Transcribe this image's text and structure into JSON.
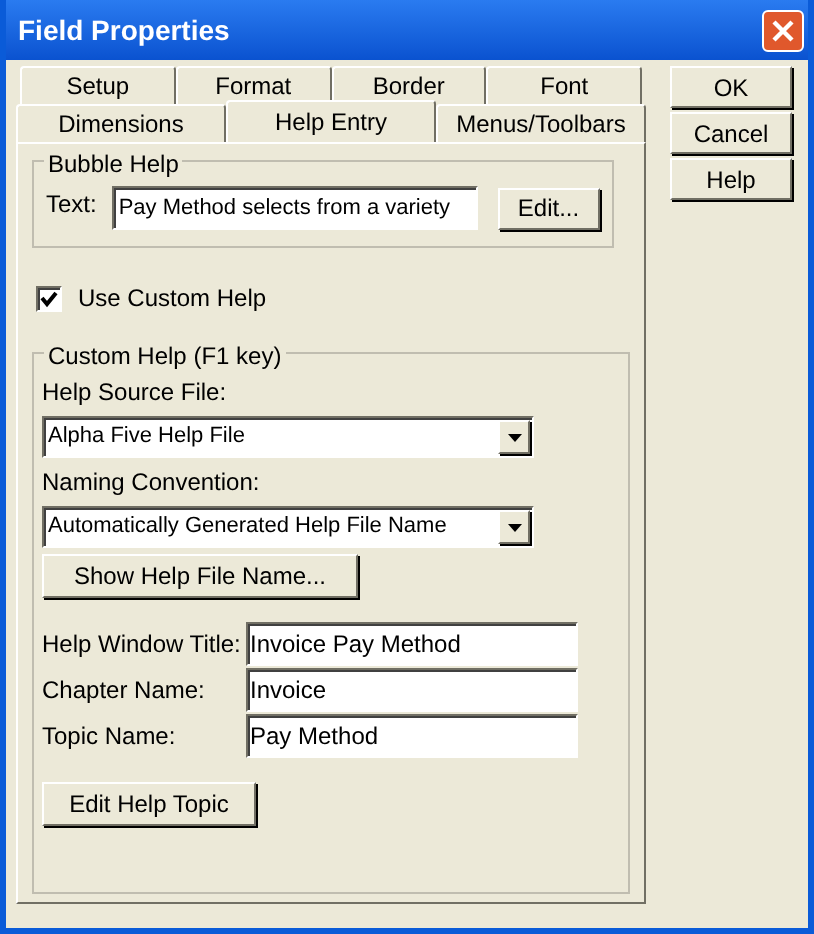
{
  "window": {
    "title": "Field Properties"
  },
  "tab_rows": [
    [
      {
        "label": "Setup",
        "selected": false
      },
      {
        "label": "Format",
        "selected": false
      },
      {
        "label": "Border",
        "selected": false
      },
      {
        "label": "Font",
        "selected": false
      }
    ],
    [
      {
        "label": "Dimensions",
        "selected": false
      },
      {
        "label": "Help Entry",
        "selected": true
      },
      {
        "label": "Menus/Toolbars",
        "selected": false
      }
    ]
  ],
  "bubble_help": {
    "title": "Bubble Help",
    "text_label": "Text:",
    "text_value": "Pay Method selects from a variety",
    "edit_button": "Edit..."
  },
  "use_custom_help": {
    "label": "Use Custom Help",
    "checked": true
  },
  "custom_help": {
    "title": "Custom Help (F1 key)",
    "source_label": "Help Source File:",
    "source_value": "Alpha Five Help File",
    "naming_label": "Naming Convention:",
    "naming_value": "Automatically Generated Help File Name",
    "show_button": "Show Help File Name...",
    "fields": [
      {
        "label": "Help Window Title:",
        "value": "Invoice Pay Method"
      },
      {
        "label": "Chapter Name:",
        "value": "Invoice"
      },
      {
        "label": "Topic Name:",
        "value": "Pay Method"
      }
    ],
    "edit_topic_button": "Edit Help Topic"
  },
  "buttons": [
    "OK",
    "Cancel",
    "Help"
  ]
}
